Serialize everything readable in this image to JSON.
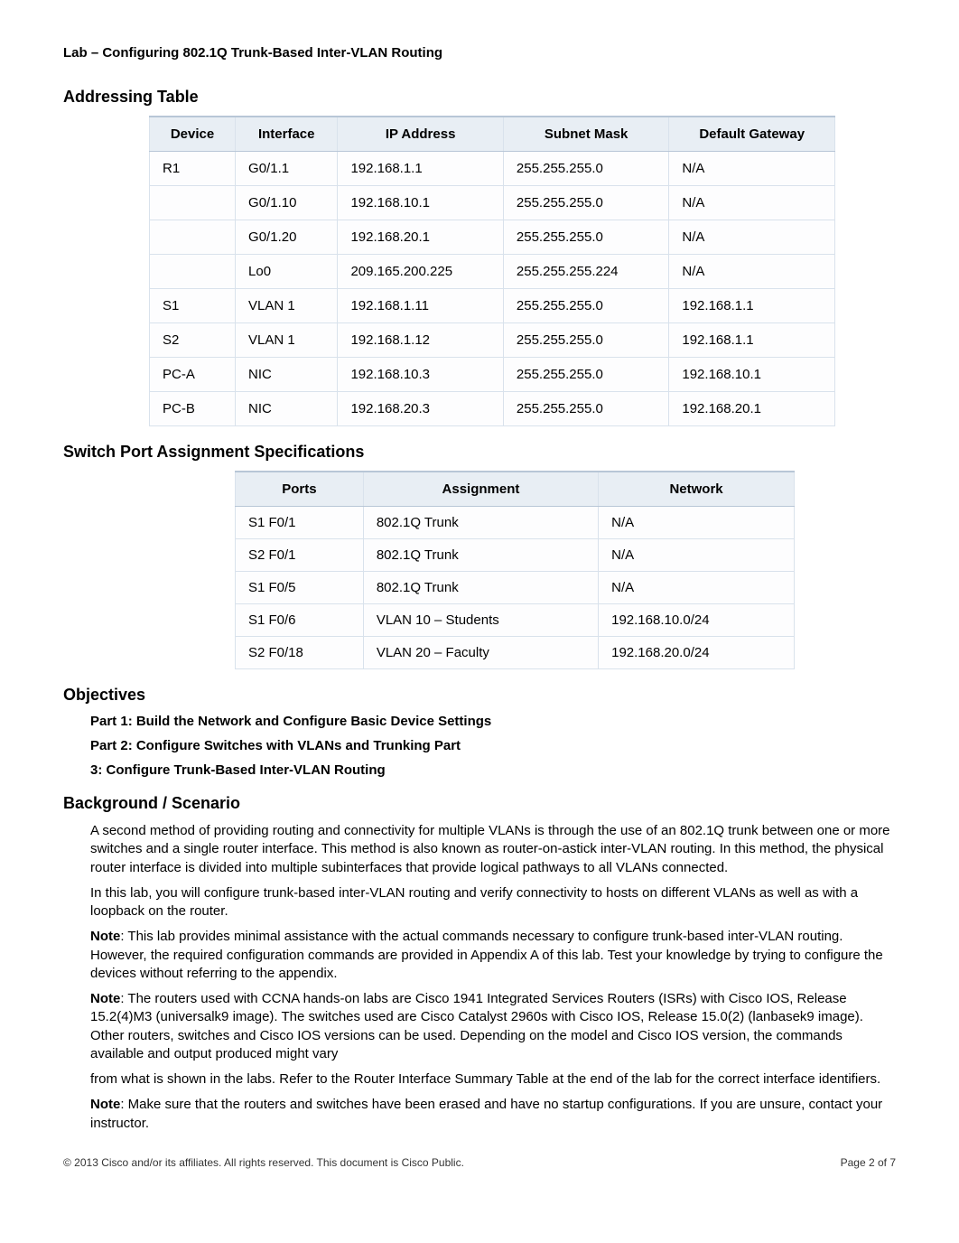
{
  "header": {
    "title": "Lab – Configuring 802.1Q Trunk-Based Inter-VLAN Routing"
  },
  "sections": {
    "addressing_heading": "Addressing Table",
    "switchport_heading": "Switch Port Assignment Specifications",
    "objectives_heading": "Objectives",
    "background_heading": "Background / Scenario"
  },
  "addressing_table": {
    "headers": {
      "device": "Device",
      "interface": "Interface",
      "ip": "IP Address",
      "mask": "Subnet Mask",
      "gw": "Default Gateway"
    },
    "rows": [
      {
        "device": "R1",
        "interface": "G0/1.1",
        "ip": "192.168.1.1",
        "mask": "255.255.255.0",
        "gw": "N/A"
      },
      {
        "device": "",
        "interface": "G0/1.10",
        "ip": "192.168.10.1",
        "mask": "255.255.255.0",
        "gw": "N/A"
      },
      {
        "device": "",
        "interface": "G0/1.20",
        "ip": "192.168.20.1",
        "mask": "255.255.255.0",
        "gw": "N/A"
      },
      {
        "device": "",
        "interface": "Lo0",
        "ip": "209.165.200.225",
        "mask": "255.255.255.224",
        "gw": "N/A"
      },
      {
        "device": "S1",
        "interface": "VLAN 1",
        "ip": "192.168.1.11",
        "mask": "255.255.255.0",
        "gw": "192.168.1.1"
      },
      {
        "device": "S2",
        "interface": "VLAN 1",
        "ip": "192.168.1.12",
        "mask": "255.255.255.0",
        "gw": "192.168.1.1"
      },
      {
        "device": "PC-A",
        "interface": "NIC",
        "ip": "192.168.10.3",
        "mask": "255.255.255.0",
        "gw": "192.168.10.1"
      },
      {
        "device": "PC-B",
        "interface": "NIC",
        "ip": "192.168.20.3",
        "mask": "255.255.255.0",
        "gw": "192.168.20.1"
      }
    ]
  },
  "port_table": {
    "headers": {
      "ports": "Ports",
      "assignment": "Assignment",
      "network": "Network"
    },
    "rows": [
      {
        "ports": "S1 F0/1",
        "assignment": "802.1Q Trunk",
        "network": "N/A"
      },
      {
        "ports": "S2 F0/1",
        "assignment": "802.1Q Trunk",
        "network": "N/A"
      },
      {
        "ports": "S1 F0/5",
        "assignment": "802.1Q Trunk",
        "network": "N/A"
      },
      {
        "ports": "S1 F0/6",
        "assignment": "VLAN 10 – Students",
        "network": "192.168.10.0/24"
      },
      {
        "ports": "S2 F0/18",
        "assignment": "VLAN 20 – Faculty",
        "network": "192.168.20.0/24"
      }
    ]
  },
  "objectives": {
    "part1": "Part 1: Build the Network and Configure Basic Device Settings",
    "part2": "Part 2: Configure Switches with VLANs and Trunking Part",
    "part3": "3: Configure Trunk-Based Inter-VLAN Routing"
  },
  "background": {
    "p1": "A second method of providing routing and connectivity for multiple VLANs is through the use of an 802.1Q trunk between one or more switches and a single router interface. This method is also known as router-on-astick inter-VLAN routing. In this method, the physical router interface is divided into multiple subinterfaces that provide logical pathways to all VLANs connected.",
    "p2": "In this lab, you will configure trunk-based inter-VLAN routing and verify connectivity to hosts on different VLANs as well as with a loopback on the router.",
    "p3_bold": "Note",
    "p3": ": This lab provides minimal assistance with the actual commands necessary to configure trunk-based inter-VLAN routing. However, the required configuration commands are provided in Appendix A of this lab. Test your knowledge by trying to configure the devices without referring to the appendix.",
    "p4_bold": "Note",
    "p4": ": The routers used with CCNA hands-on labs are Cisco 1941 Integrated Services Routers (ISRs) with Cisco IOS, Release 15.2(4)M3 (universalk9 image). The switches used are Cisco Catalyst 2960s with Cisco IOS, Release 15.0(2) (lanbasek9 image). Other routers, switches and Cisco IOS versions can be used. Depending on the model and Cisco IOS version, the commands available and output produced might vary",
    "p5": "from what is shown in the labs. Refer to the Router Interface Summary Table at the end of the lab for the correct interface identifiers.",
    "p6_bold": "Note",
    "p6": ": Make sure that the routers and switches have been erased and have no startup configurations. If you are unsure, contact your instructor."
  },
  "footer": {
    "left": "© 2013 Cisco and/or its affiliates. All rights reserved. This document is Cisco Public.",
    "right": "Page 2 of 7"
  }
}
